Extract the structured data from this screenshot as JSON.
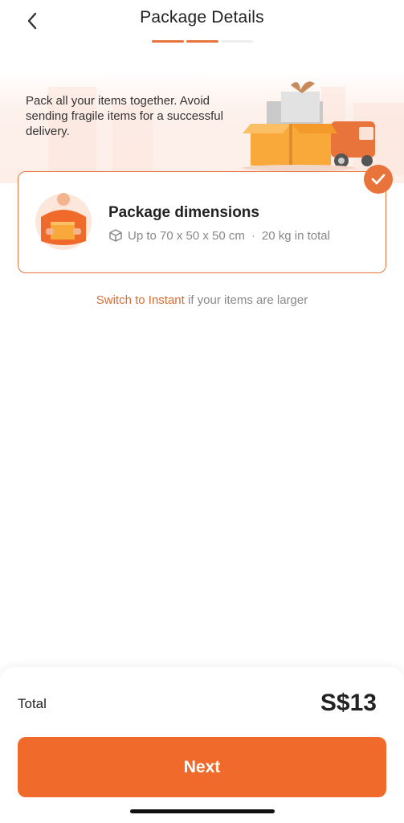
{
  "header": {
    "title": "Package Details",
    "back_icon": "chevron-left-icon",
    "steps_total": 3,
    "steps_completed": 2
  },
  "banner": {
    "text": "Pack all your items together. Avoid sending fragile items for a successful delivery."
  },
  "package_option": {
    "title": "Package dimensions",
    "dimensions": "Up to 70 x 50 x 50 cm",
    "weight": "20 kg in total",
    "selected": true,
    "selected_icon": "check-icon"
  },
  "switch": {
    "link_text": "Switch to Instant",
    "suffix": "if your items are larger"
  },
  "footer": {
    "total_label": "Total",
    "total_value": "S$13",
    "next_label": "Next"
  },
  "colors": {
    "accent": "#ef6a2b",
    "border_accent": "#e8743b",
    "link": "#d96c35"
  }
}
